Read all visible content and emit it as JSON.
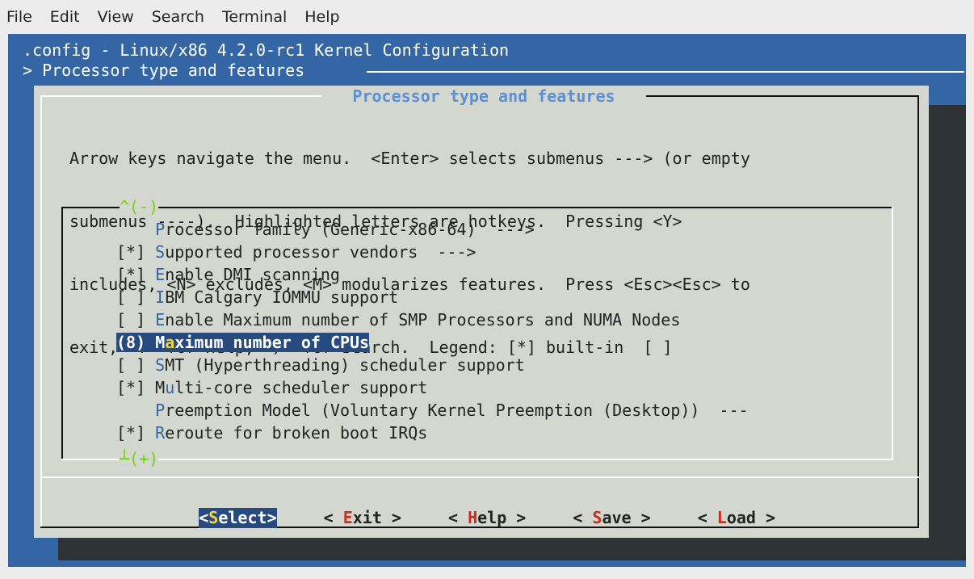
{
  "menubar": [
    "File",
    "Edit",
    "View",
    "Search",
    "Terminal",
    "Help"
  ],
  "header": {
    "title": ".config - Linux/x86 4.2.0-rc1 Kernel Configuration",
    "breadcrumb": "> Processor type and features "
  },
  "dialog": {
    "title": " Processor type and features ",
    "help_lines": [
      "Arrow keys navigate the menu.  <Enter> selects submenus ---> (or empty",
      "submenus ----).  Highlighted letters are hotkeys.  Pressing <Y>",
      "includes, <N> excludes, <M> modularizes features.  Press <Esc><Esc> to",
      "exit, <?> for Help, </> for Search.  Legend: [*] built-in  [ ]"
    ],
    "scroll_up": "^(-)",
    "scroll_down": "┴(+)"
  },
  "items": [
    {
      "prefix": "    ",
      "hotkey": "P",
      "rest": "rocessor family (Generic-x86-64)  --->"
    },
    {
      "prefix": "[*] ",
      "hotkey": "S",
      "rest": "upported processor vendors  --->"
    },
    {
      "prefix": "[*] ",
      "hotkey": "E",
      "rest": "nable DMI scanning"
    },
    {
      "prefix": "[ ] ",
      "hotkey": "I",
      "rest": "BM Calgary IOMMU support"
    },
    {
      "prefix": "[ ] ",
      "hotkey": "E",
      "rest": "nable Maximum number of SMP Processors and NUMA Nodes"
    },
    {
      "prefix_open": "(",
      "prefix_val": "8",
      "prefix_close": ") ",
      "pre": "M",
      "hotkey": "a",
      "rest": "ximum number of CPUs",
      "selected": true
    },
    {
      "prefix": "[ ] ",
      "hotkey": "S",
      "rest": "MT (Hyperthreading) scheduler support"
    },
    {
      "prefix": "[*] ",
      "hotkey": "M",
      "hotkey_pre": "",
      "rest_pre": "M",
      "hotkey2": "u",
      "rest": "lti-core scheduler support",
      "special": true
    },
    {
      "prefix": "    ",
      "hotkey": "P",
      "rest": "reemption Model (Voluntary Kernel Preemption (Desktop))  ---"
    },
    {
      "prefix": "[*] ",
      "hotkey": "R",
      "rest": "eroute for broken boot IRQs"
    }
  ],
  "buttons": [
    {
      "open": "<",
      "hotkey": "S",
      "rest": "elect",
      "close": ">",
      "active": true
    },
    {
      "open": "< ",
      "hotkey": "E",
      "rest": "xit",
      "close": " >",
      "active": false
    },
    {
      "open": "< ",
      "hotkey": "H",
      "rest": "elp",
      "close": " >",
      "active": false
    },
    {
      "open": "< ",
      "hotkey": "S",
      "rest": "ave",
      "close": " >",
      "active": false
    },
    {
      "open": "< ",
      "hotkey": "L",
      "rest": "oad",
      "close": " >",
      "active": false
    }
  ]
}
